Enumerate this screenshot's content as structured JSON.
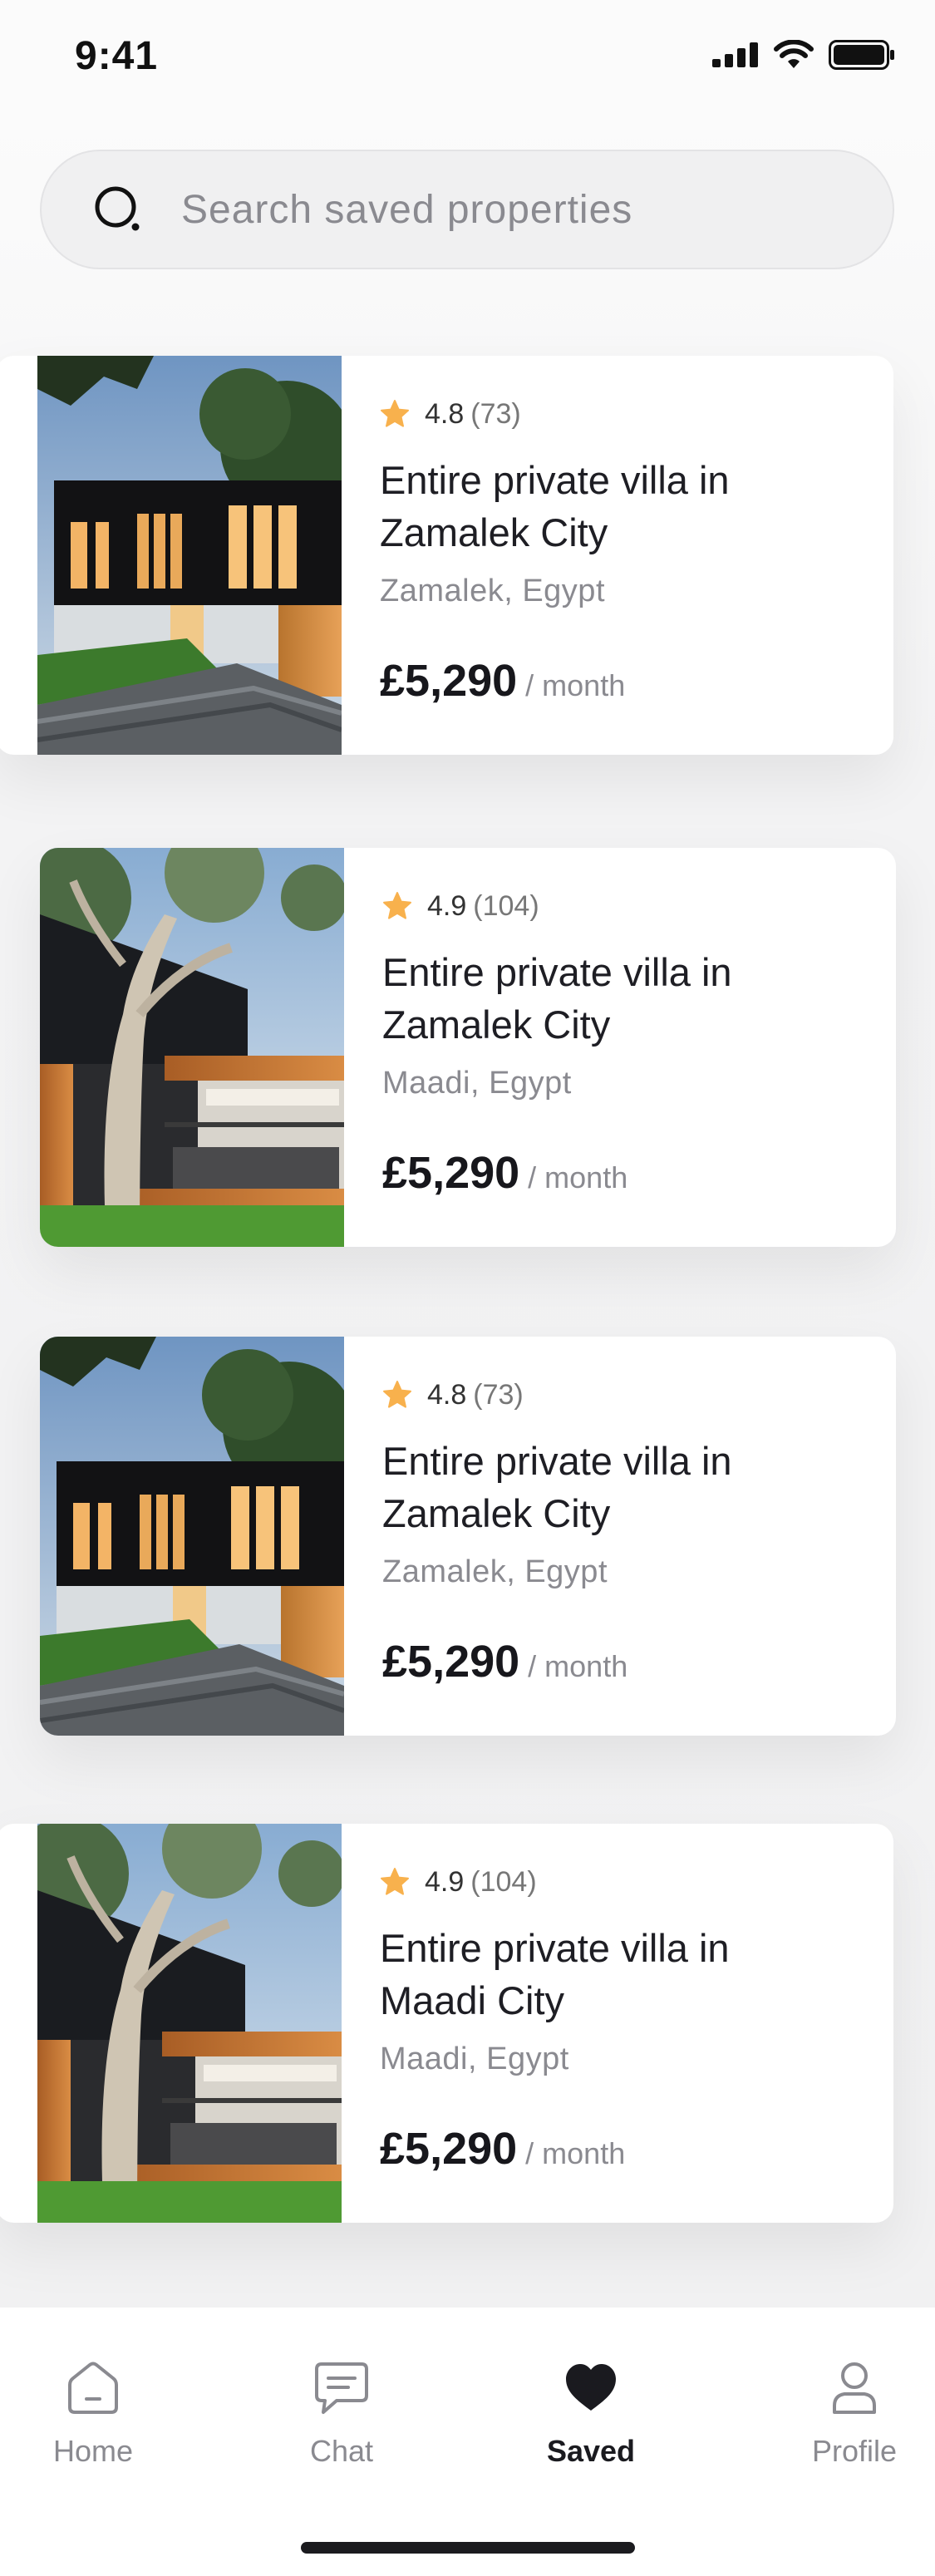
{
  "status": {
    "time": "9:41"
  },
  "search": {
    "placeholder": "Search saved properties"
  },
  "listings": [
    {
      "rating": "4.8",
      "reviews": "(73)",
      "title": "Entire private villa in Zamalek City",
      "location": "Zamalek, Egypt",
      "price": "£5,290",
      "period": "/ month",
      "photo": "modern-villa-dark"
    },
    {
      "rating": "4.9",
      "reviews": "(104)",
      "title": "Entire private villa in Zamalek City",
      "location": "Maadi, Egypt",
      "price": "£5,290",
      "period": "/ month",
      "photo": "villa-with-tree"
    },
    {
      "rating": "4.8",
      "reviews": "(73)",
      "title": "Entire private villa in Zamalek City",
      "location": "Zamalek, Egypt",
      "price": "£5,290",
      "period": "/ month",
      "photo": "modern-villa-dark"
    },
    {
      "rating": "4.9",
      "reviews": "(104)",
      "title": "Entire private villa in Maadi City",
      "location": "Maadi, Egypt",
      "price": "£5,290",
      "period": "/ month",
      "photo": "villa-with-tree"
    }
  ],
  "tabs": [
    {
      "label": "Home",
      "icon": "home-icon",
      "active": false
    },
    {
      "label": "Chat",
      "icon": "chat-icon",
      "active": false
    },
    {
      "label": "Saved",
      "icon": "heart-icon",
      "active": true
    },
    {
      "label": "Profile",
      "icon": "profile-icon",
      "active": false
    }
  ],
  "colors": {
    "star": "#f8b14d",
    "text": "#1e1e24",
    "muted": "#8a8a90",
    "active_tab": "#1a1a1f"
  }
}
